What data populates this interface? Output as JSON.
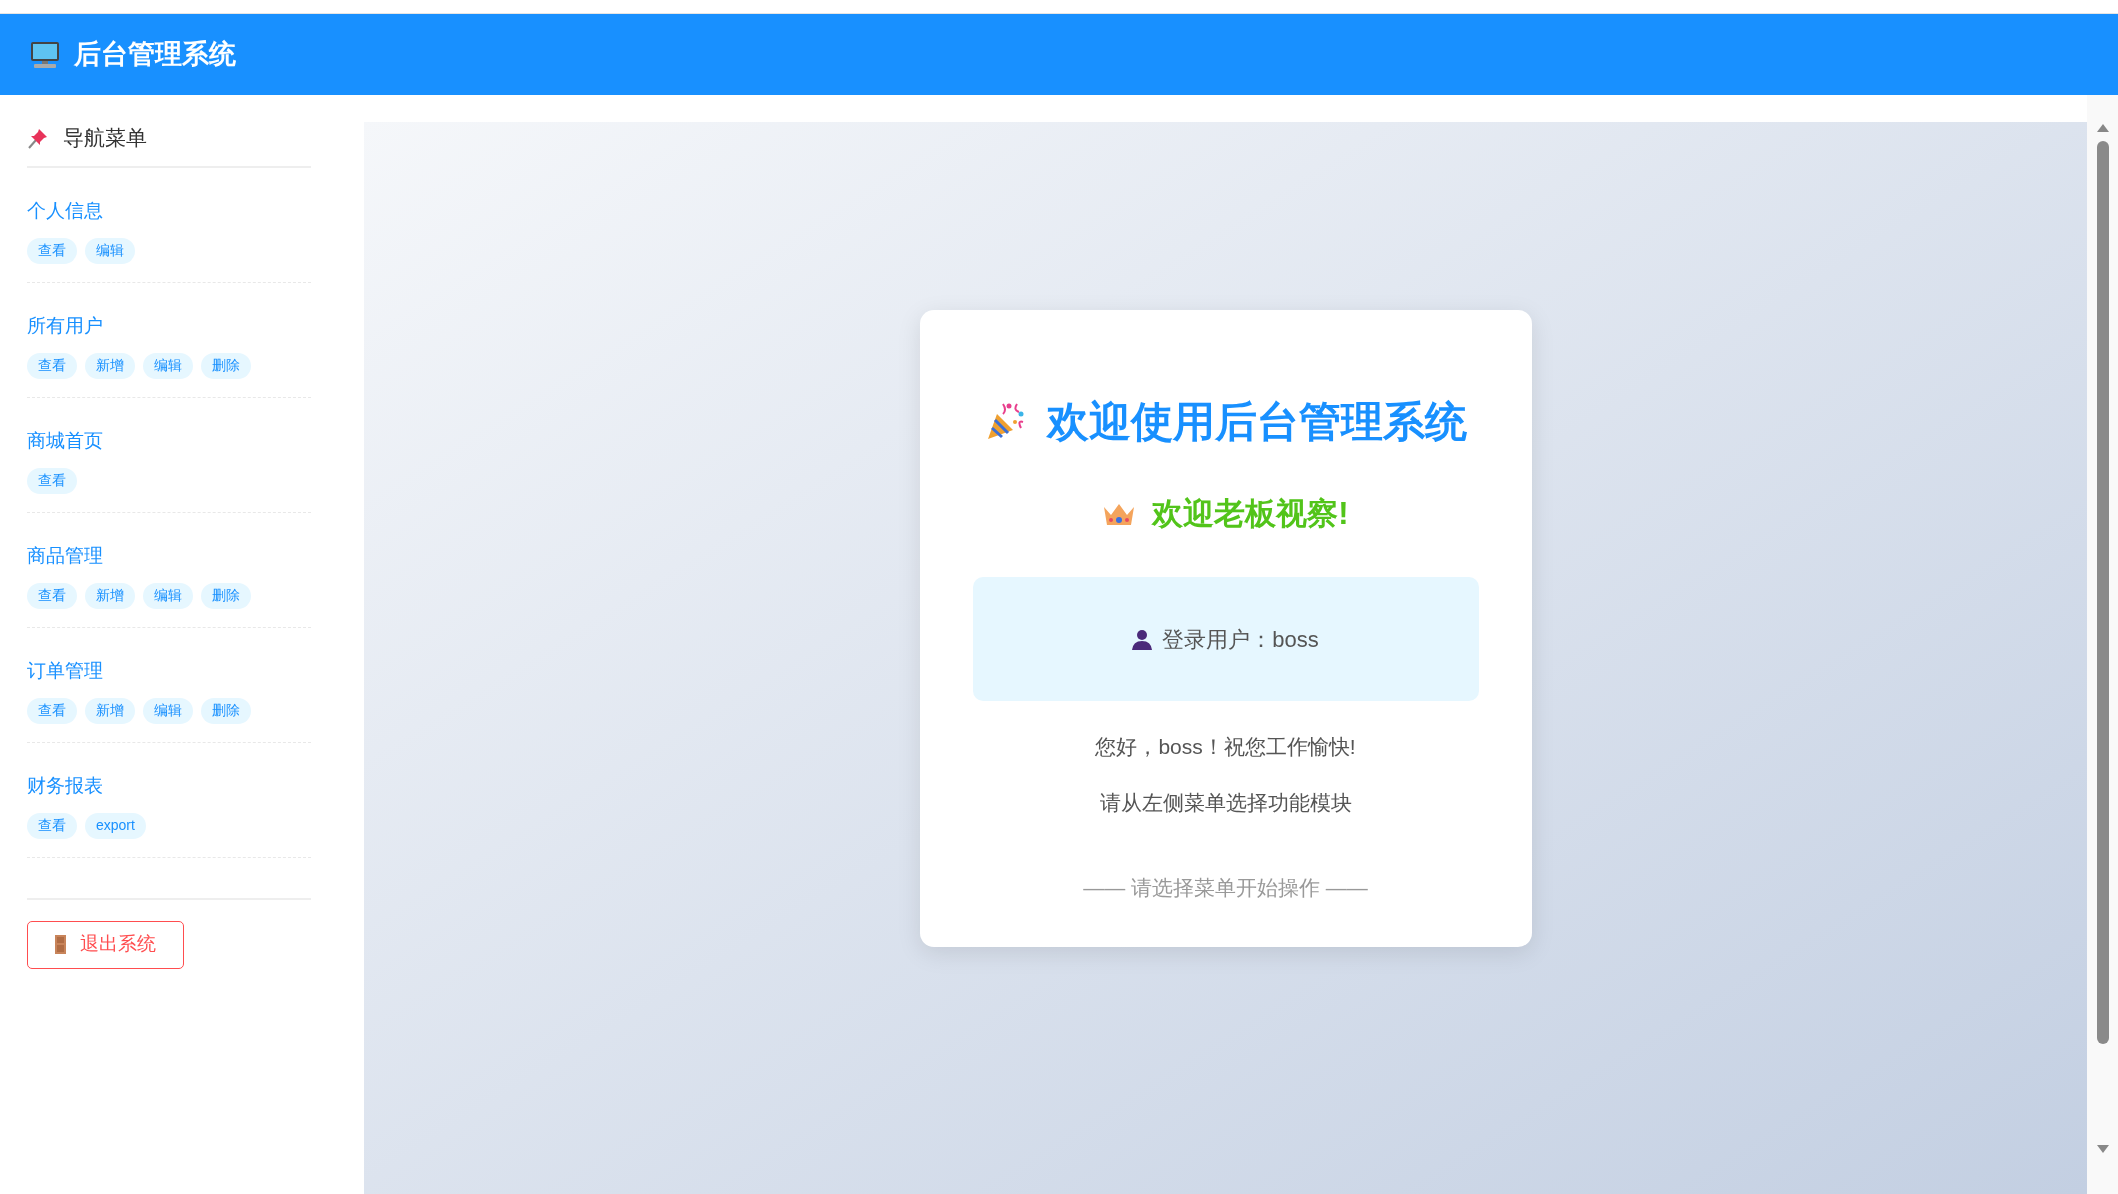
{
  "header": {
    "title": "后台管理系统"
  },
  "sidebar": {
    "heading": "导航菜单",
    "menus": [
      {
        "title": "个人信息",
        "actions": [
          "查看",
          "编辑"
        ]
      },
      {
        "title": "所有用户",
        "actions": [
          "查看",
          "新增",
          "编辑",
          "删除"
        ]
      },
      {
        "title": "商城首页",
        "actions": [
          "查看"
        ]
      },
      {
        "title": "商品管理",
        "actions": [
          "查看",
          "新增",
          "编辑",
          "删除"
        ]
      },
      {
        "title": "订单管理",
        "actions": [
          "查看",
          "新增",
          "编辑",
          "删除"
        ]
      },
      {
        "title": "财务报表",
        "actions": [
          "查看",
          "export"
        ]
      }
    ],
    "logout": "退出系统"
  },
  "welcome": {
    "title": "欢迎使用后台管理系统",
    "greeting": "欢迎老板视察!",
    "login_user": "登录用户：boss",
    "message": "您好，boss！祝您工作愉快!",
    "hint": "请从左侧菜单选择功能模块",
    "footer": "—— 请选择菜单开始操作 ——"
  }
}
